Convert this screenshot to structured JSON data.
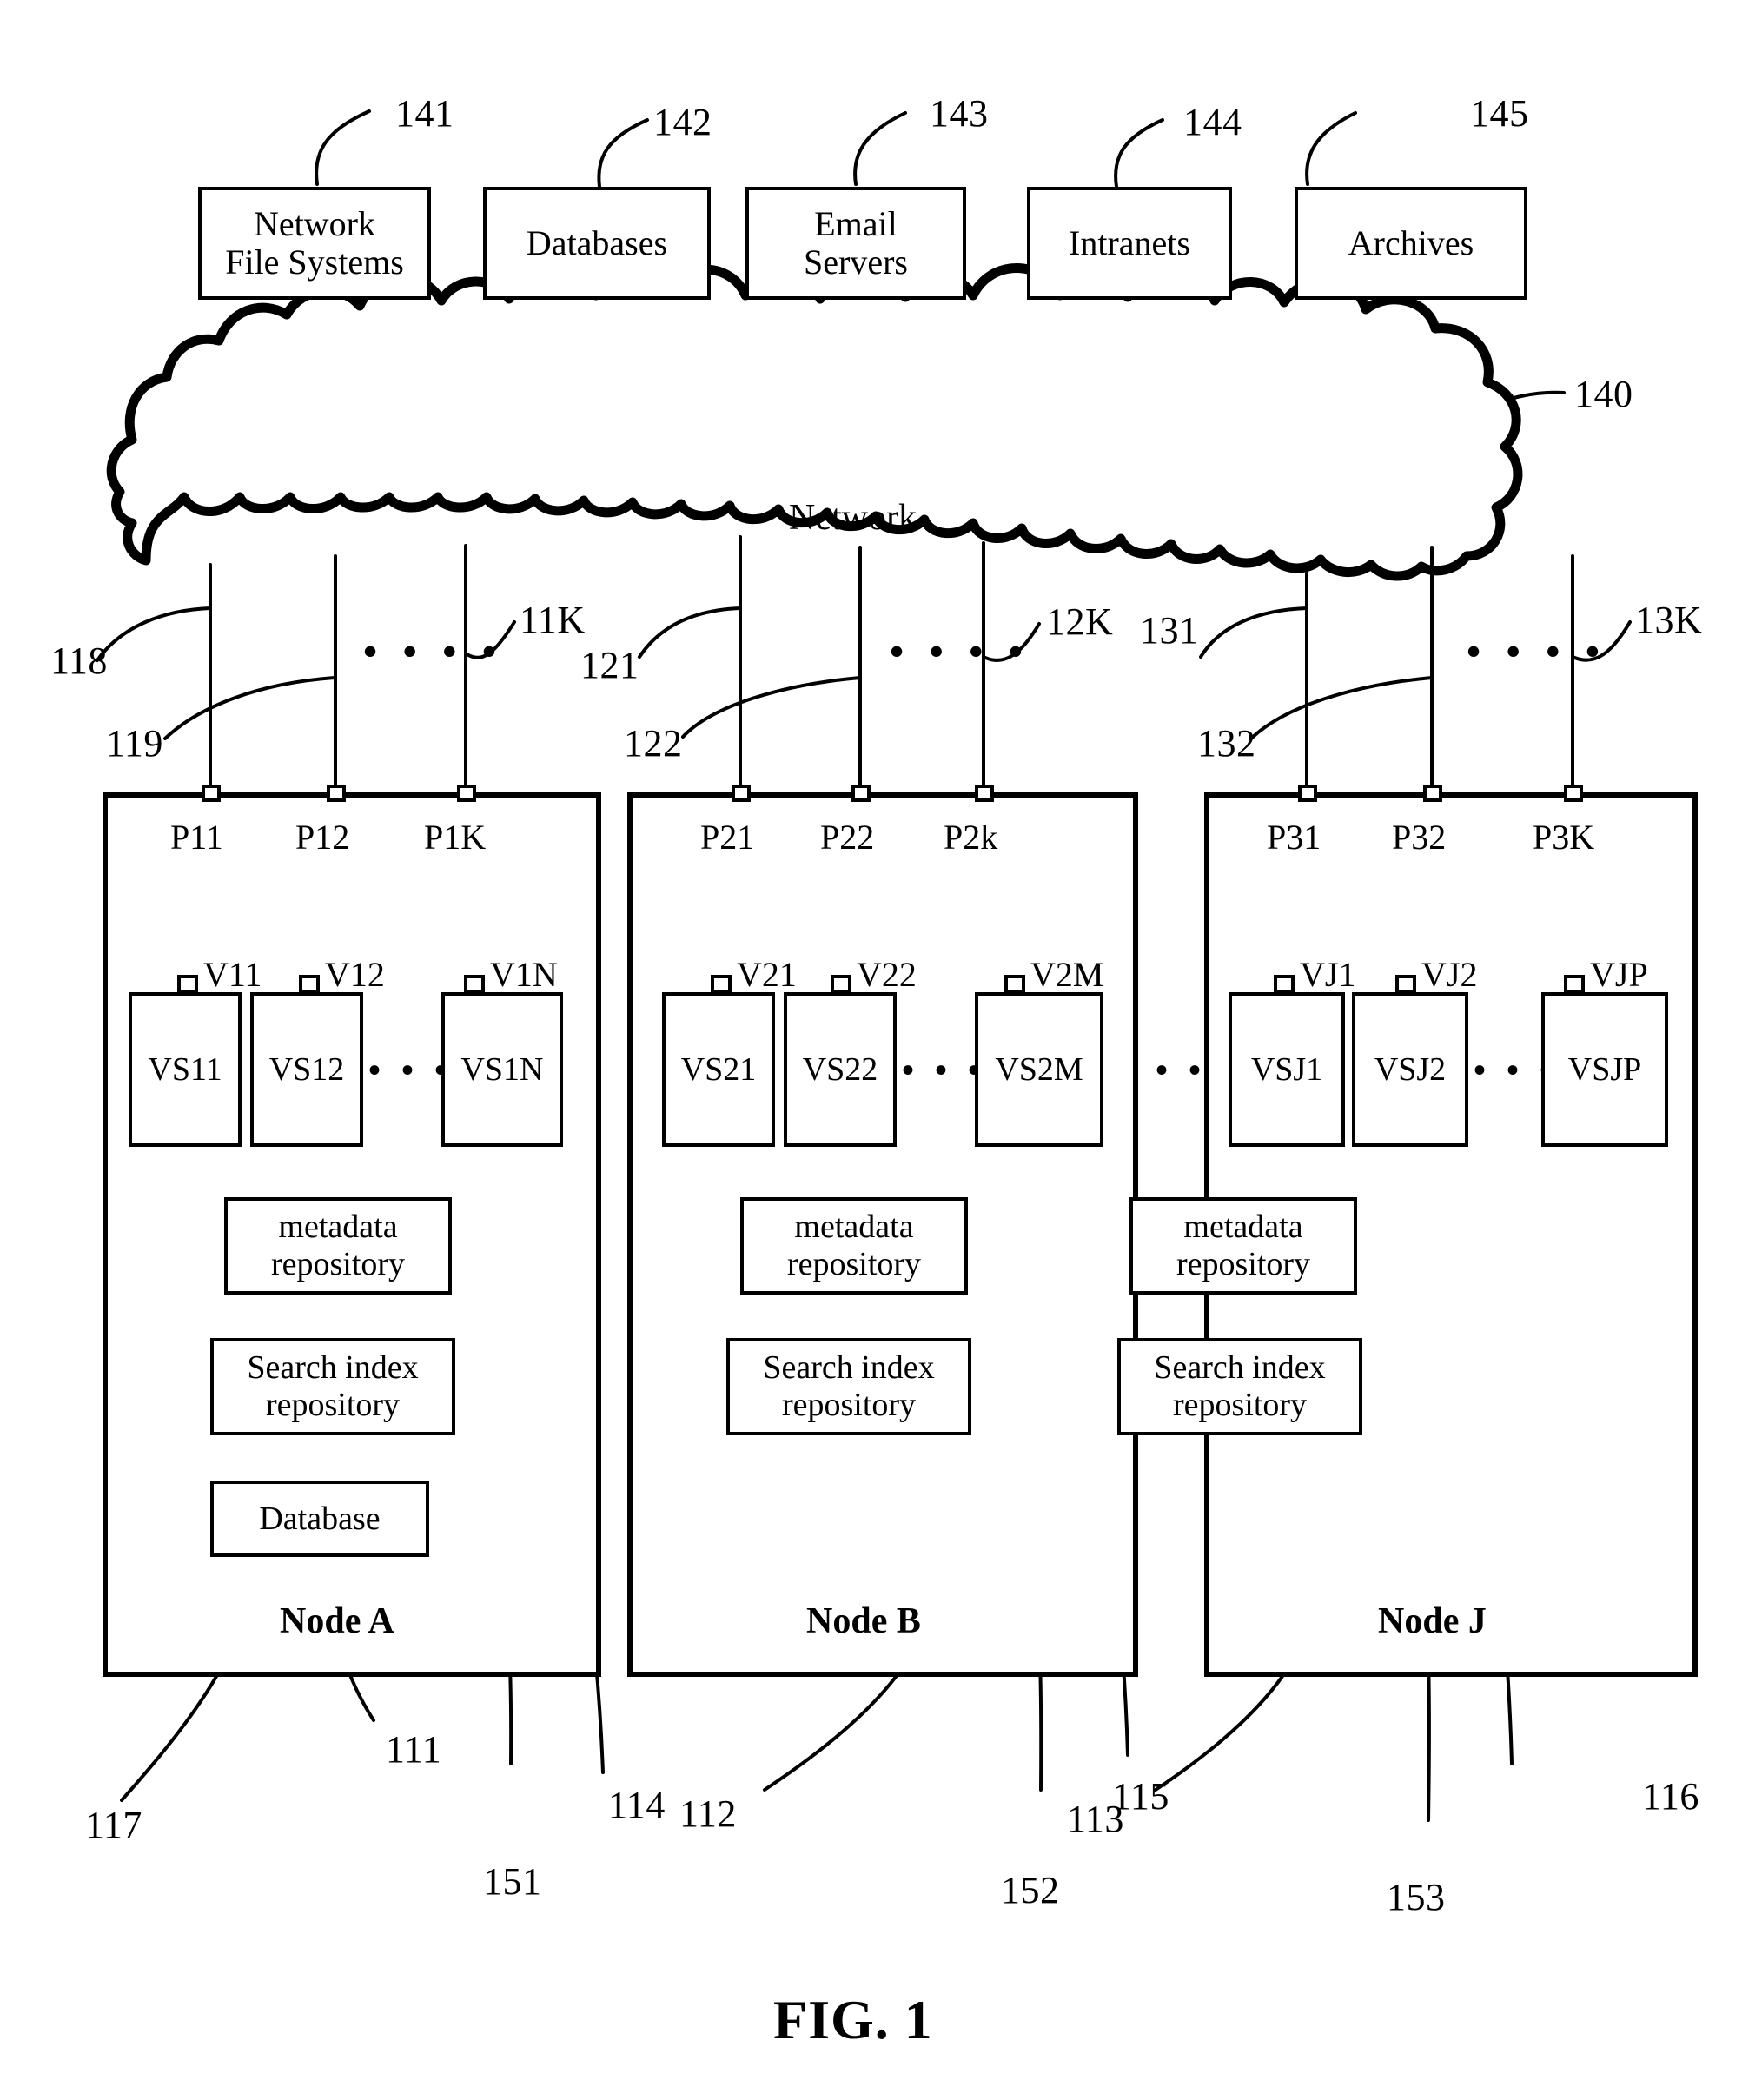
{
  "figure": {
    "caption": "FIG. 1",
    "network_label": "Network",
    "network_ref": "140"
  },
  "sources": [
    {
      "label": "Network\nFile Systems",
      "ref": "141"
    },
    {
      "label": "Databases",
      "ref": "142"
    },
    {
      "label": "Email\nServers",
      "ref": "143"
    },
    {
      "label": "Intranets",
      "ref": "144"
    },
    {
      "label": "Archives",
      "ref": "145"
    }
  ],
  "link_refs": {
    "group_a": [
      "118",
      "119",
      "11K"
    ],
    "group_b": [
      "121",
      "122",
      "12K"
    ],
    "group_c": [
      "131",
      "132",
      "13K"
    ]
  },
  "ellipsis": "• • • •",
  "ellipsis_small": "• • •",
  "nodes": [
    {
      "name": "Node A",
      "ports": [
        "P11",
        "P12",
        "P1K"
      ],
      "volumes": [
        "V11",
        "V12",
        "V1N"
      ],
      "stores": [
        "VS11",
        "VS12",
        "VS1N"
      ],
      "repos": [
        "metadata\nrepository",
        "Search index\nrepository",
        "Database"
      ],
      "refs": {
        "node": "111",
        "metadata": "114",
        "search": "151",
        "database": "117"
      }
    },
    {
      "name": "Node B",
      "ports": [
        "P21",
        "P22",
        "P2k"
      ],
      "volumes": [
        "V21",
        "V22",
        "V2M"
      ],
      "stores": [
        "VS21",
        "VS22",
        "VS2M"
      ],
      "repos": [
        "metadata\nrepository",
        "Search index\nrepository"
      ],
      "refs": {
        "node": "112",
        "metadata": "115",
        "search": "152"
      }
    },
    {
      "name": "Node J",
      "ports": [
        "P31",
        "P32",
        "P3K"
      ],
      "volumes": [
        "VJ1",
        "VJ2",
        "VJP"
      ],
      "stores": [
        "VSJ1",
        "VSJ2",
        "VSJP"
      ],
      "repos": [
        "metadata\nrepository",
        "Search index\nrepository"
      ],
      "refs": {
        "node": "113",
        "metadata": "116",
        "search": "153"
      }
    }
  ],
  "colors": {
    "ink": "#000000",
    "paper": "#ffffff"
  }
}
